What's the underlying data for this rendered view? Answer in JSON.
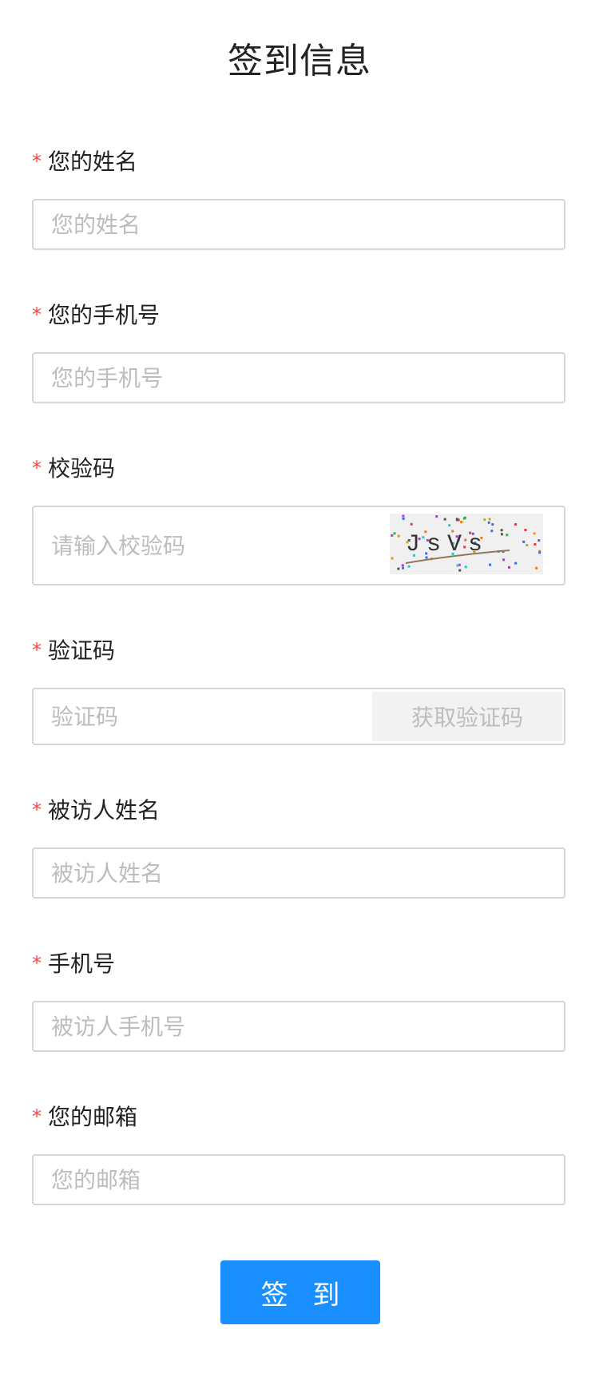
{
  "page": {
    "title": "签到信息"
  },
  "form": {
    "required_mark": "*",
    "name": {
      "label": "您的姓名",
      "placeholder": "您的姓名"
    },
    "phone": {
      "label": "您的手机号",
      "placeholder": "您的手机号"
    },
    "captcha": {
      "label": "校验码",
      "placeholder": "请输入校验码",
      "image_text": "JsVs"
    },
    "sms_code": {
      "label": "验证码",
      "placeholder": "验证码",
      "button": "获取验证码"
    },
    "visitee_name": {
      "label": "被访人姓名",
      "placeholder": "被访人姓名"
    },
    "visitee_phone": {
      "label": "手机号",
      "placeholder": "被访人手机号"
    },
    "email": {
      "label": "您的邮箱",
      "placeholder": "您的邮箱"
    },
    "submit": "签 到"
  },
  "colors": {
    "accent": "#1a8fff",
    "required": "#f04848",
    "border": "#d6d6d6",
    "placeholder": "#bdbdbd"
  }
}
